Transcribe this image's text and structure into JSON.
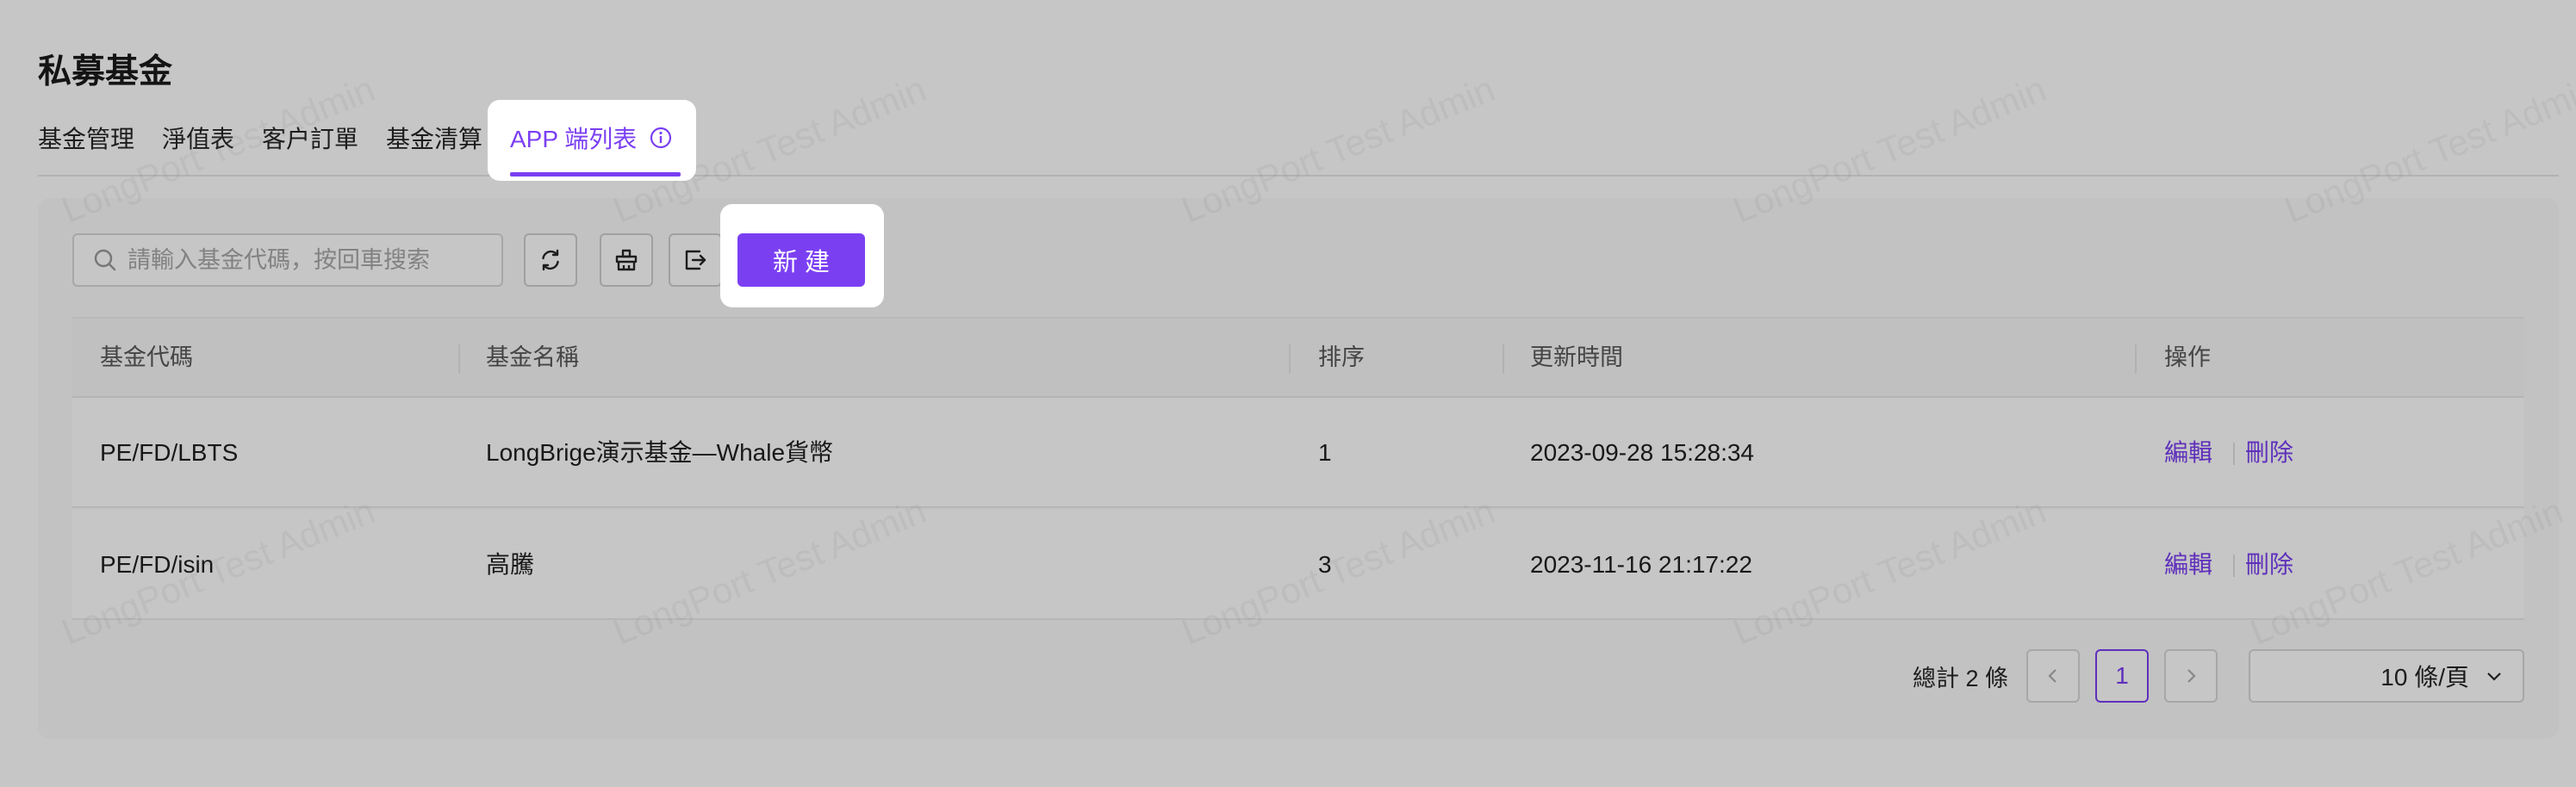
{
  "page": {
    "title": "私募基金"
  },
  "tabs": {
    "items": [
      {
        "label": "基金管理"
      },
      {
        "label": "淨值表"
      },
      {
        "label": "客户訂單"
      },
      {
        "label": "基金清算"
      }
    ],
    "active": {
      "label": "APP 端列表",
      "icon": "info-circle-icon"
    }
  },
  "toolbar": {
    "search_placeholder": "請輸入基金代碼，按回車搜索",
    "refresh_icon": "refresh-icon",
    "clear_icon": "clear-icon",
    "export_icon": "export-icon",
    "new_label": "新建"
  },
  "table": {
    "columns": [
      "基金代碼",
      "基金名稱",
      "排序",
      "更新時間",
      "操作"
    ],
    "rows": [
      {
        "code": "PE/FD/LBTS",
        "name": "LongBrige演示基金—Whale貨幣",
        "order": "1",
        "updated": "2023-09-28 15:28:34",
        "edit": "編輯",
        "delete": "刪除"
      },
      {
        "code": "PE/FD/isin",
        "name": "高騰",
        "order": "3",
        "updated": "2023-11-16 21:17:22",
        "edit": "編輯",
        "delete": "刪除"
      }
    ]
  },
  "pagination": {
    "total_text": "總計 2 條",
    "current_page": "1",
    "page_size": "10 條/頁"
  },
  "watermark": "LongPort Test Admin",
  "colors": {
    "accent": "#7b3ff2",
    "overlay": "rgba(0,0,0,0.225)"
  }
}
